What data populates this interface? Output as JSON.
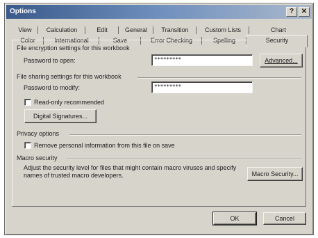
{
  "window": {
    "title": "Options"
  },
  "tabs": {
    "row1": [
      "View",
      "Calculation",
      "Edit",
      "General",
      "Transition",
      "Custom Lists",
      "Chart"
    ],
    "row2": [
      "Color",
      "International",
      "Save",
      "Error Checking",
      "Spelling",
      "Security"
    ],
    "active": "Security"
  },
  "encryption": {
    "header": "File encryption settings for this workbook",
    "password_open_label": "Password to open:",
    "password_open_value": "*********",
    "advanced_button": "Advanced..."
  },
  "sharing": {
    "header": "File sharing settings for this workbook",
    "password_modify_label": "Password to modify:",
    "password_modify_value": "*********",
    "read_only_label": "Read-only recommended",
    "read_only_checked": false,
    "digital_signatures_button": "Digital Signatures..."
  },
  "privacy": {
    "header": "Privacy options",
    "remove_info_label": "Remove personal information from this file on save",
    "remove_info_checked": false
  },
  "macro": {
    "header": "Macro security",
    "description": "Adjust the security level for files that might contain macro viruses and specify names of trusted macro developers.",
    "button": "Macro Security..."
  },
  "footer": {
    "ok": "OK",
    "cancel": "Cancel"
  }
}
